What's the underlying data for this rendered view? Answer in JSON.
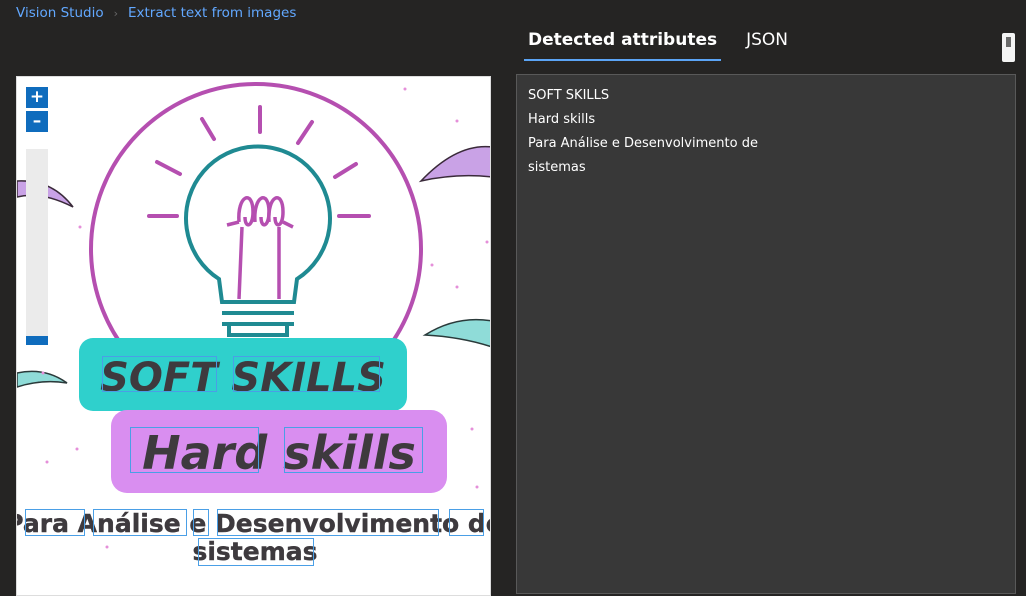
{
  "breadcrumb": {
    "root": "Vision Studio",
    "current": "Extract text from images"
  },
  "tabs": [
    {
      "label": "Detected attributes",
      "active": true
    },
    {
      "label": "JSON",
      "active": false
    }
  ],
  "zoom": {
    "in_label": "+",
    "out_label": "–"
  },
  "image": {
    "line1": "SOFT SKILLS",
    "line2": "Hard skills",
    "line3": "Para Análise e Desenvolvimento de",
    "line4": "sistemas",
    "colors": {
      "circle": "#b54fb0",
      "bulb": "#1f8a92",
      "teal_box": "#2fd0cc",
      "purple_box": "#d98ef0",
      "text": "#3e3a3e"
    }
  },
  "results": {
    "lines": [
      "SOFT SKILLS",
      "Hard skills",
      "Para Análise e Desenvolvimento de",
      "sistemas"
    ]
  },
  "accent": "#5ba4f5"
}
